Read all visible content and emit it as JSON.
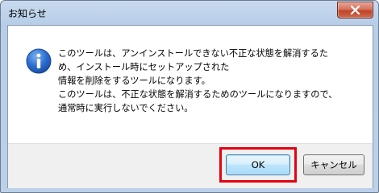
{
  "window": {
    "title": "お知らせ",
    "close_icon": "close-icon"
  },
  "message": {
    "icon": "info-icon",
    "lines": [
      "このツールは、アンインストールできない不正な状態を解消するた",
      "め、インストール時にセットアップされた",
      "情報を削除をするツールになります。",
      "このツールは、不正な状態を解消するためのツールになりますので、",
      "通常時に実行しないでください。"
    ]
  },
  "buttons": {
    "ok_label": "OK",
    "cancel_label": "キャンセル"
  },
  "colors": {
    "highlight": "#e60012",
    "info_icon": "#1f5fbf",
    "close_button": "#c0432a"
  }
}
